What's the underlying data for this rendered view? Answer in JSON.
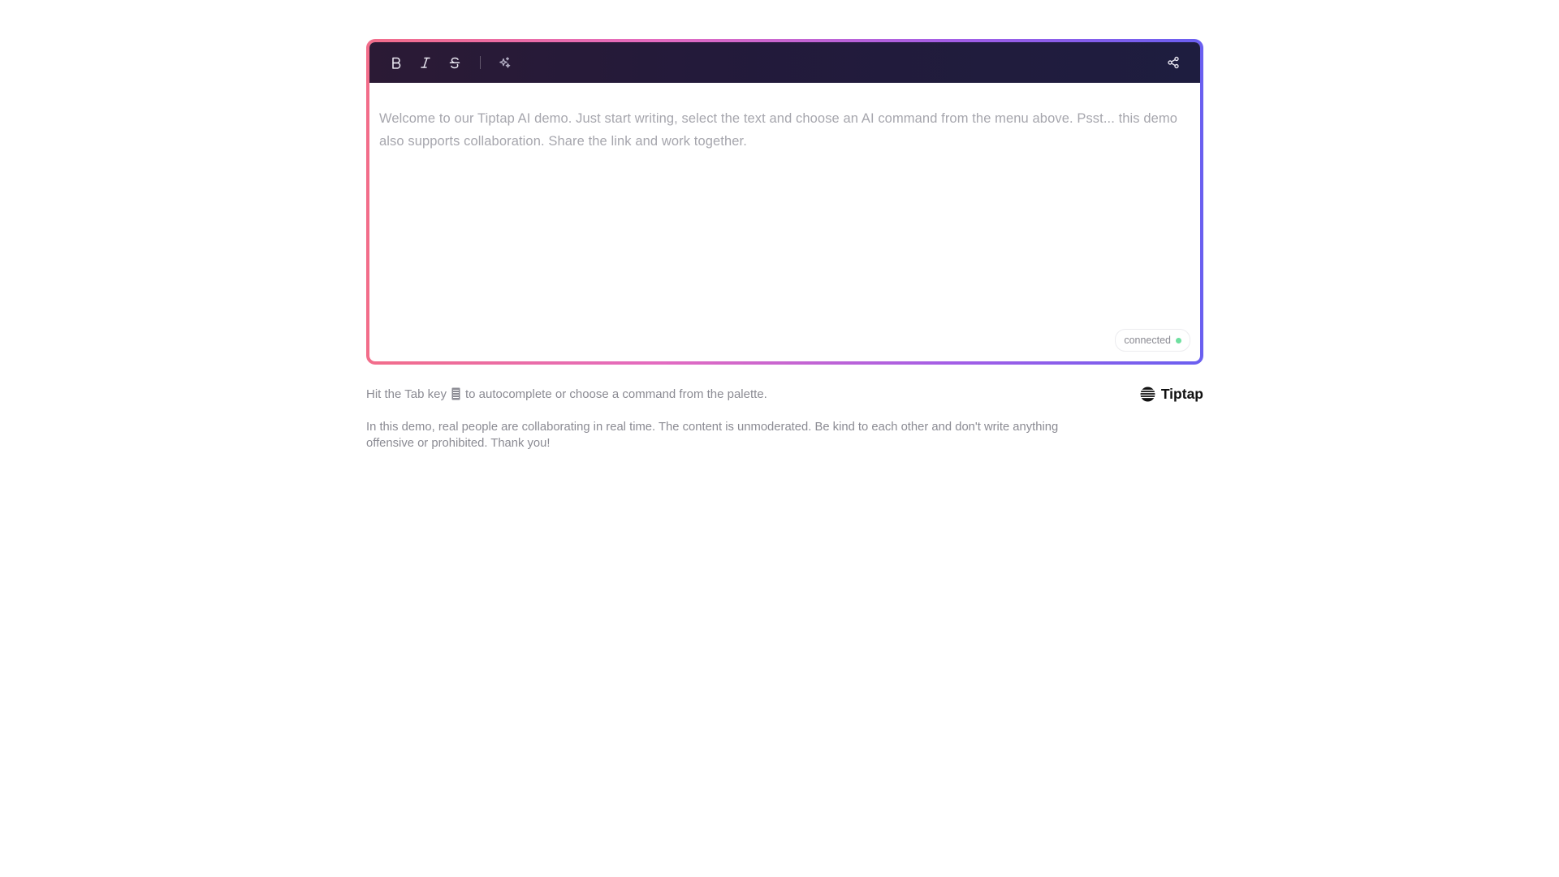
{
  "toolbar": {
    "bold_icon": "bold-icon",
    "italic_icon": "italic-icon",
    "strike_icon": "strikethrough-icon",
    "ai_icon": "ai-sparkles-icon",
    "share_icon": "share-icon"
  },
  "editor": {
    "placeholder": "Welcome to our Tiptap AI demo. Just start writing, select the text and choose an AI command from the menu above. Psst... this demo also supports collaboration. Share the link and work together."
  },
  "status": {
    "label": "connected",
    "dot_color": "#6fe0a0"
  },
  "hint": {
    "before_key": "Hit the Tab key",
    "after_key": "to autocomplete or choose a command from the palette.",
    "key_icon": "tab-key-icon"
  },
  "brand": {
    "name": "Tiptap",
    "logo_icon": "tiptap-logo-icon"
  },
  "notice": {
    "text": "In this demo, real people are collaborating in real time. The content is unmoderated. Be kind to each other and don't write anything offensive or prohibited. Thank you!"
  },
  "colors": {
    "frame_gradient": [
      "#f26d8a",
      "#e36bc0",
      "#a35ee6",
      "#6a5ff0"
    ],
    "toolbar_bg": "#231a3a",
    "placeholder_text": "#a6a6ad",
    "muted_text": "#8b8b93"
  }
}
